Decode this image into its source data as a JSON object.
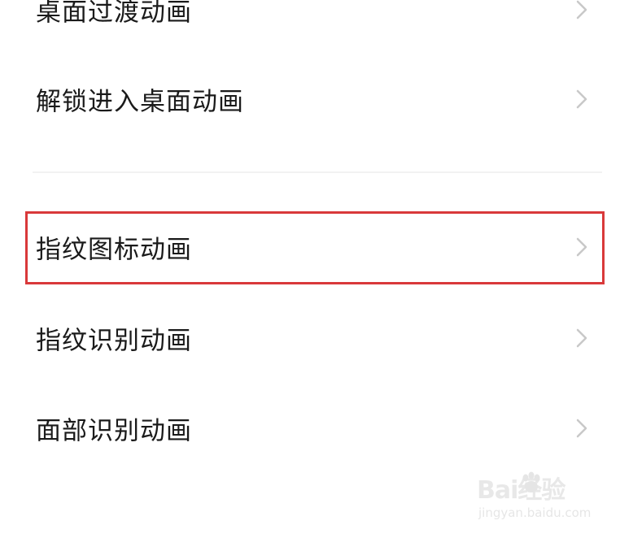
{
  "settings_list": {
    "items": [
      {
        "label": "桌面过渡动画"
      },
      {
        "label": "解锁进入桌面动画"
      },
      {
        "label": "指纹图标动画",
        "highlighted": true
      },
      {
        "label": "指纹识别动画"
      },
      {
        "label": "面部识别动画"
      }
    ]
  },
  "highlight": {
    "color": "#d9393a"
  },
  "chevron_icon": "chevron-right-icon",
  "watermark": {
    "logo": "Bai经验",
    "url": "jingyan.baidu.com"
  }
}
